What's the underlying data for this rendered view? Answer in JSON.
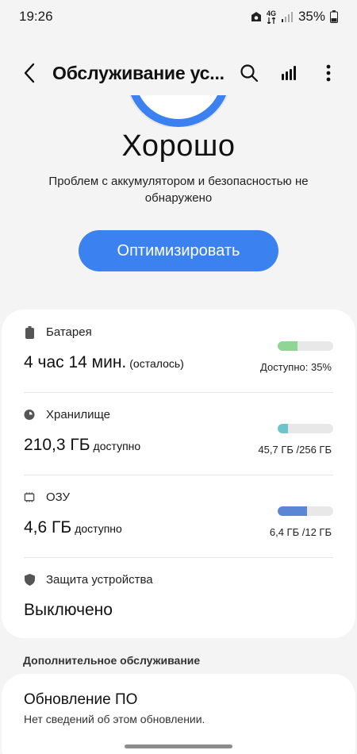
{
  "status_bar": {
    "time": "19:26",
    "network": "4G",
    "battery": "35%"
  },
  "toolbar": {
    "title": "Обслуживание ус..."
  },
  "status": {
    "title": "Хорошо",
    "description": "Проблем с аккумулятором и безопасностью не обнаружено"
  },
  "optimize_label": "Оптимизировать",
  "battery": {
    "label": "Батарея",
    "value": "4 час 14 мин.",
    "suffix": "(осталось)",
    "detail": "Доступно: 35%",
    "level": 0.35,
    "color": "#8fd694"
  },
  "storage": {
    "label": "Хранилище",
    "value": "210,3 ГБ",
    "suffix": "доступно",
    "detail": "45,7 ГБ  /256 ГБ",
    "level": 0.18,
    "color": "#6cc6c9"
  },
  "ram": {
    "label": "ОЗУ",
    "value": "4,6 ГБ",
    "suffix": "доступно",
    "detail": "6,4 ГБ  /12 ГБ",
    "level": 0.53,
    "color": "#5b86d6"
  },
  "protection": {
    "label": "Защита устройства",
    "value": "Выключено"
  },
  "additional": {
    "header": "Дополнительное обслуживание",
    "update_title": "Обновление ПО",
    "update_subtitle": "Нет сведений об этом обновлении."
  },
  "colors": {
    "accent": "#3b82f0",
    "background": "#f4f4f4",
    "card": "#ffffff"
  }
}
